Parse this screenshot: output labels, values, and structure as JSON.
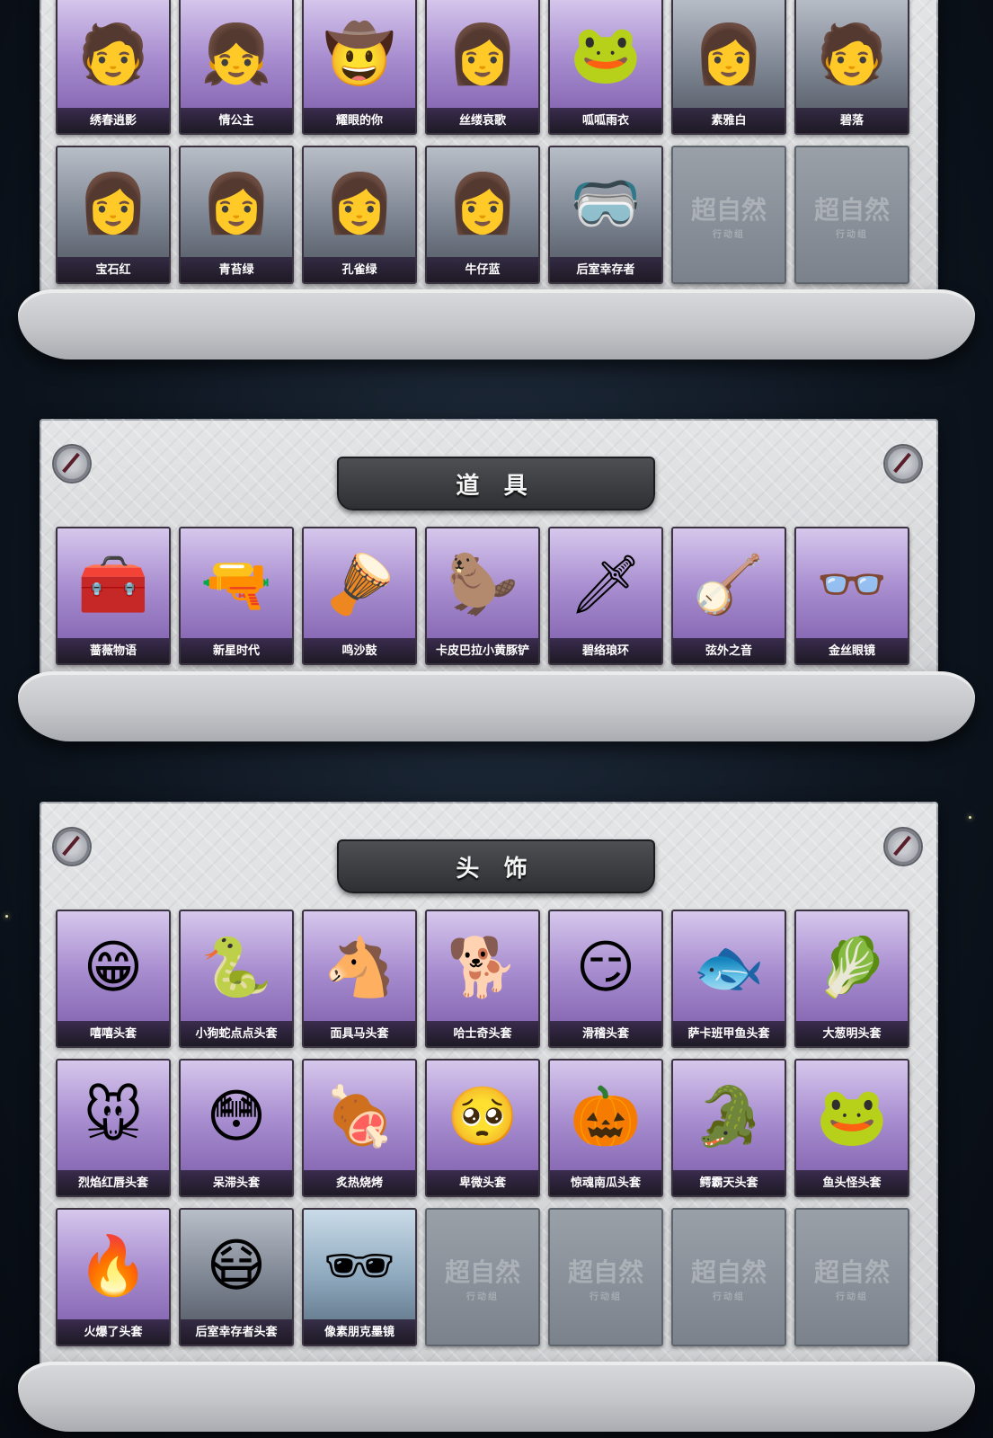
{
  "sections": {
    "characters": {
      "rows": [
        [
          {
            "label": "绣春逍影",
            "icon": "character-portrait-icon",
            "style": "purple",
            "art": "🧑"
          },
          {
            "label": "情公主",
            "icon": "character-portrait-icon",
            "style": "purple",
            "art": "👧"
          },
          {
            "label": "耀眼的你",
            "icon": "character-portrait-icon",
            "style": "purple",
            "art": "🤠"
          },
          {
            "label": "丝缕哀歌",
            "icon": "character-portrait-icon",
            "style": "purple",
            "art": "👩"
          },
          {
            "label": "呱呱雨衣",
            "icon": "character-portrait-icon",
            "style": "purple",
            "art": "🐸"
          },
          {
            "label": "素雅白",
            "icon": "character-portrait-icon",
            "style": "gray",
            "art": "👩"
          },
          {
            "label": "碧落",
            "icon": "character-portrait-icon",
            "style": "gray",
            "art": "🧑"
          }
        ],
        [
          {
            "label": "宝石红",
            "icon": "character-portrait-icon",
            "style": "gray",
            "art": "👩"
          },
          {
            "label": "青苔绿",
            "icon": "character-portrait-icon",
            "style": "gray",
            "art": "👩"
          },
          {
            "label": "孔雀绿",
            "icon": "character-portrait-icon",
            "style": "gray",
            "art": "👩"
          },
          {
            "label": "牛仔蓝",
            "icon": "character-portrait-icon",
            "style": "gray",
            "art": "👩"
          },
          {
            "label": "后室幸存者",
            "icon": "character-portrait-icon",
            "style": "gray",
            "art": "🥽"
          },
          {
            "label": "",
            "icon": "empty-slot-icon",
            "style": "empty",
            "art": ""
          },
          {
            "label": "",
            "icon": "empty-slot-icon",
            "style": "empty",
            "art": ""
          }
        ]
      ]
    },
    "props": {
      "title": "道 具",
      "items": [
        {
          "label": "蔷薇物语",
          "icon": "first-aid-kit-icon",
          "style": "purple",
          "art": "🧰"
        },
        {
          "label": "新星时代",
          "icon": "revolver-icon",
          "style": "purple",
          "art": "🔫"
        },
        {
          "label": "鸣沙鼓",
          "icon": "drum-charm-icon",
          "style": "purple",
          "art": "🪘"
        },
        {
          "label": "卡皮巴拉小黄豚铲",
          "icon": "capybara-shovel-icon",
          "style": "purple",
          "art": "🦫"
        },
        {
          "label": "碧络琅环",
          "icon": "blade-icon",
          "style": "purple",
          "art": "🗡"
        },
        {
          "label": "弦外之音",
          "icon": "lute-icon",
          "style": "purple",
          "art": "🪕"
        },
        {
          "label": "金丝眼镜",
          "icon": "glasses-icon",
          "style": "purple",
          "art": "👓"
        }
      ]
    },
    "headwear": {
      "title": "头 饰",
      "rows": [
        [
          {
            "label": "嘻嘻头套",
            "icon": "grin-mask-icon",
            "style": "purple",
            "art": "😁"
          },
          {
            "label": "小狗蛇点点头套",
            "icon": "snake-mask-icon",
            "style": "purple",
            "art": "🐍"
          },
          {
            "label": "面具马头套",
            "icon": "horse-mask-icon",
            "style": "purple",
            "art": "🐴"
          },
          {
            "label": "哈士奇头套",
            "icon": "dog-mask-icon",
            "style": "purple",
            "art": "🐕"
          },
          {
            "label": "滑稽头套",
            "icon": "smirk-mask-icon",
            "style": "purple",
            "art": "😏"
          },
          {
            "label": "萨卡班甲鱼头套",
            "icon": "fish-mask-icon",
            "style": "purple",
            "art": "🐟"
          },
          {
            "label": "大葱明头套",
            "icon": "scallion-mask-icon",
            "style": "purple",
            "art": "🥬"
          }
        ],
        [
          {
            "label": "烈焰红唇头套",
            "icon": "pikachu-mask-icon",
            "style": "purple",
            "art": "🐭"
          },
          {
            "label": "呆滞头套",
            "icon": "dazed-mask-icon",
            "style": "purple",
            "art": "😳"
          },
          {
            "label": "炙热烧烤",
            "icon": "grill-mask-icon",
            "style": "purple",
            "art": "🍖"
          },
          {
            "label": "卑微头套",
            "icon": "humble-mask-icon",
            "style": "purple",
            "art": "🥺"
          },
          {
            "label": "惊魂南瓜头套",
            "icon": "pumpkin-mask-icon",
            "style": "purple",
            "art": "🎃"
          },
          {
            "label": "鳄霸天头套",
            "icon": "crocodile-mask-icon",
            "style": "purple",
            "art": "🐊"
          },
          {
            "label": "鱼头怪头套",
            "icon": "fishman-mask-icon",
            "style": "purple",
            "art": "🐸"
          }
        ],
        [
          {
            "label": "火爆了头套",
            "icon": "flame-mask-icon",
            "style": "purple",
            "art": "🔥"
          },
          {
            "label": "后室幸存者头套",
            "icon": "gas-mask-icon",
            "style": "gray",
            "art": "😷"
          },
          {
            "label": "像素朋克墨镜",
            "icon": "pixel-sunglasses-icon",
            "style": "blue",
            "art": "🕶"
          },
          {
            "label": "",
            "icon": "empty-slot-icon",
            "style": "empty",
            "art": ""
          },
          {
            "label": "",
            "icon": "empty-slot-icon",
            "style": "empty",
            "art": ""
          },
          {
            "label": "",
            "icon": "empty-slot-icon",
            "style": "empty",
            "art": ""
          },
          {
            "label": "",
            "icon": "empty-slot-icon",
            "style": "empty",
            "art": ""
          }
        ]
      ]
    }
  },
  "empty_slot": {
    "brand": "超自然",
    "subtitle": "行动组"
  },
  "colors": {
    "card_purple": "#a78ccf",
    "card_gray": "#7f8794",
    "panel": "#d7d8da",
    "banner": "#2e3034"
  }
}
